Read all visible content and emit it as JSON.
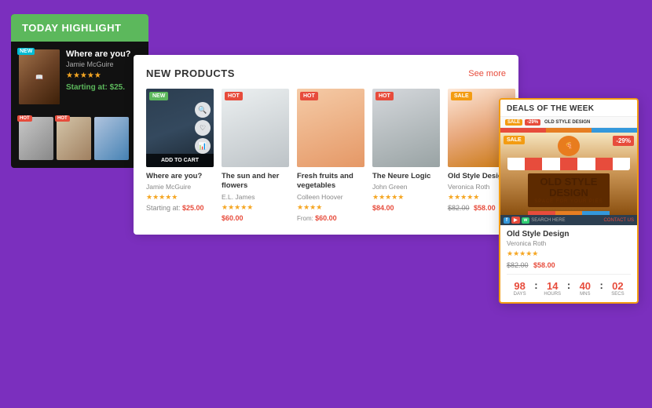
{
  "background_color": "#7b2fbe",
  "today_highlight": {
    "header": "TODAY HIGHLIGHT",
    "main_item": {
      "title": "Where are you?",
      "author": "Jamie McGuire",
      "stars": "★★★★★",
      "price_label": "Starting at:",
      "price": "$25.",
      "badge": "NEW"
    },
    "thumbnails": [
      {
        "badge": "HOT"
      },
      {
        "badge": "HOT"
      },
      {
        "badge": ""
      }
    ]
  },
  "new_products": {
    "title": "NEW PRODUCTS",
    "see_more": "See more",
    "products": [
      {
        "title": "Where are you?",
        "author": "Jamie McGuire",
        "stars": "★★★★★",
        "price_label": "Starting at:",
        "price": "$25.00",
        "badge": "NEW",
        "badge_type": "new",
        "show_cart": true,
        "show_icons": true
      },
      {
        "title": "The sun and her flowers",
        "author": "E.L. James",
        "stars": "★★★★★",
        "price": "$60.00",
        "badge": "HOT",
        "badge_type": "hot",
        "show_cart": false,
        "show_icons": false
      },
      {
        "title": "Fresh fruits and vegetables",
        "author": "Colleen Hoover",
        "stars": "★★★★",
        "price_from": "From:",
        "price": "$60.00",
        "badge": "HOT",
        "badge_type": "hot",
        "show_cart": false,
        "show_icons": false
      },
      {
        "title": "The Neure Logic",
        "author": "John Green",
        "stars": "★★★★★",
        "price": "$84.00",
        "badge": "HOT",
        "badge_type": "hot",
        "show_cart": false,
        "show_icons": false
      },
      {
        "title": "Old Style Design",
        "author": "Veronica Roth",
        "stars": "★★★★★",
        "price_original": "$82.00",
        "price": "$58.00",
        "badge": "SALE",
        "badge_type": "sale",
        "show_cart": false,
        "show_icons": false
      }
    ]
  },
  "deals_of_week": {
    "title": "DEALS OF THE WEEK",
    "product_title": "Old Style Design",
    "product_author": "Veronica Roth",
    "stars": "★★★★★",
    "price_original": "$82.00",
    "price_current": "$58.00",
    "sale_badge": "SALE",
    "discount": "-29%",
    "countdown": {
      "days_num": "98",
      "days_label": "DAYS",
      "hours_num": "14",
      "hours_label": "HOURS",
      "mins_num": "40",
      "mins_label": "MNS",
      "secs_num": "02",
      "secs_label": "SECS"
    }
  }
}
